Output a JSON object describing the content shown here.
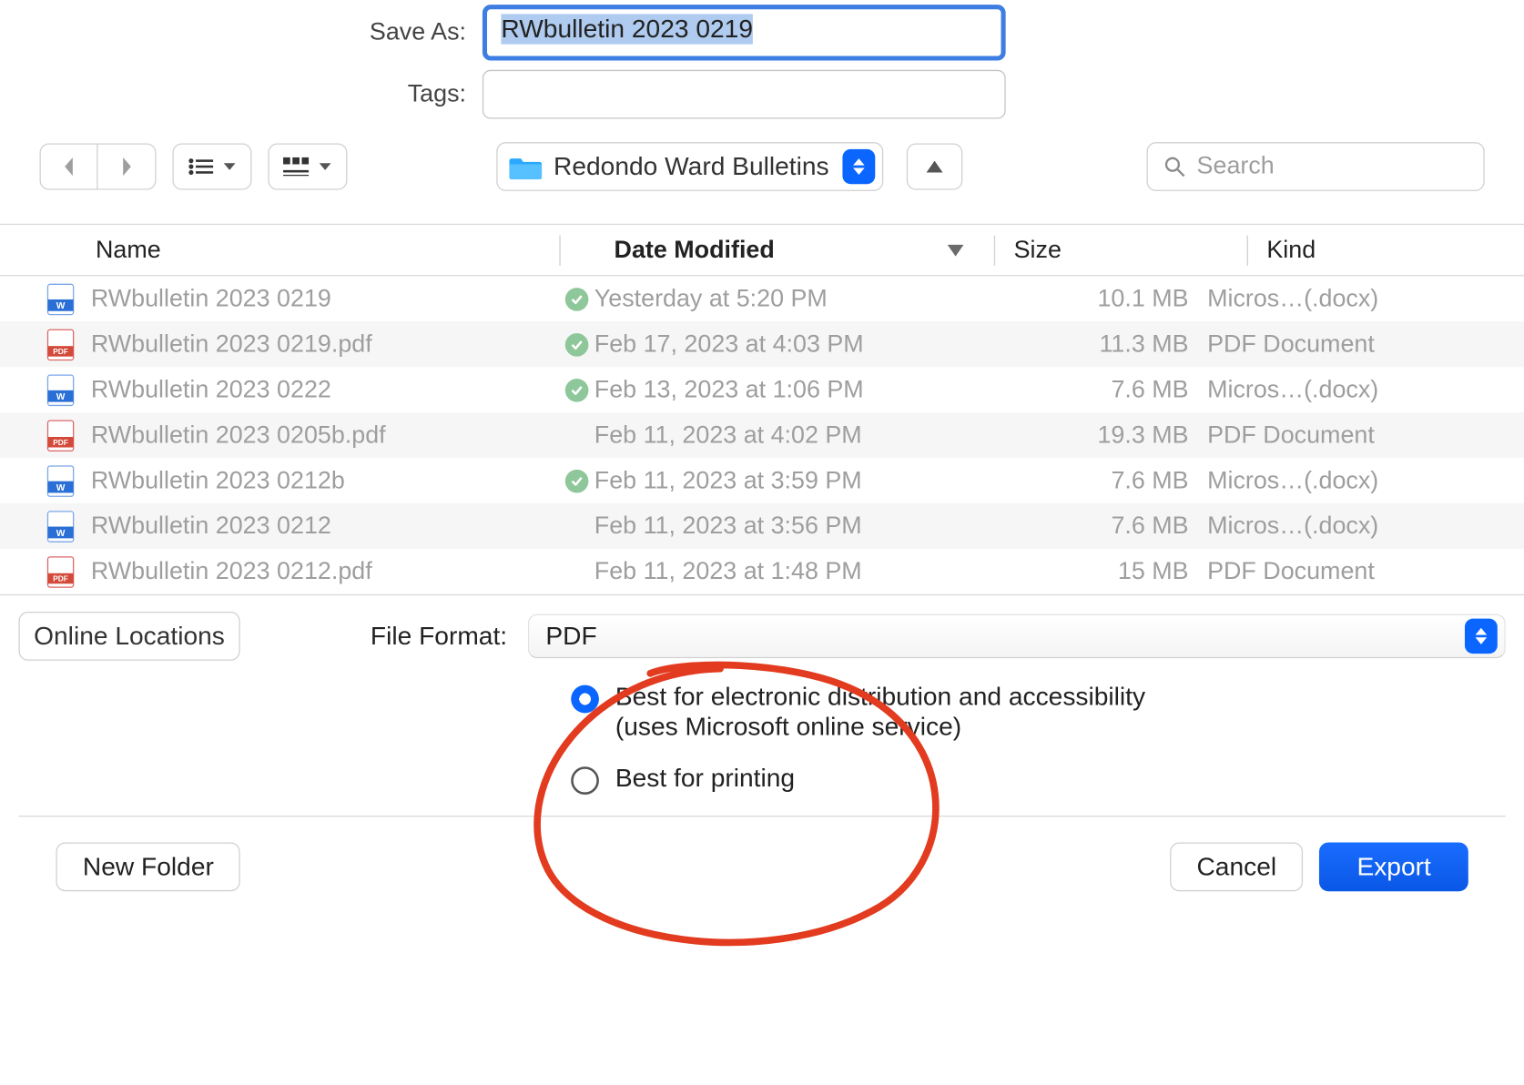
{
  "form": {
    "save_as_label": "Save As:",
    "save_as_value": "RWbulletin 2023 0219",
    "tags_label": "Tags:",
    "tags_value": ""
  },
  "toolbar": {
    "folder_name": "Redondo Ward Bulletins",
    "search_placeholder": "Search"
  },
  "columns": {
    "name": "Name",
    "date": "Date Modified",
    "size": "Size",
    "kind": "Kind"
  },
  "files": [
    {
      "icon": "docx",
      "name": "RWbulletin 2023 0219",
      "synced": true,
      "date": "Yesterday at 5:20 PM",
      "size": "10.1 MB",
      "kind": "Micros…(.docx)"
    },
    {
      "icon": "pdf",
      "name": "RWbulletin 2023 0219.pdf",
      "synced": true,
      "date": "Feb 17, 2023 at 4:03 PM",
      "size": "11.3 MB",
      "kind": "PDF Document"
    },
    {
      "icon": "docx",
      "name": "RWbulletin 2023 0222",
      "synced": true,
      "date": "Feb 13, 2023 at 1:06 PM",
      "size": "7.6 MB",
      "kind": "Micros…(.docx)"
    },
    {
      "icon": "pdf",
      "name": "RWbulletin 2023 0205b.pdf",
      "synced": false,
      "date": "Feb 11, 2023 at 4:02 PM",
      "size": "19.3 MB",
      "kind": "PDF Document"
    },
    {
      "icon": "docx",
      "name": "RWbulletin 2023 0212b",
      "synced": true,
      "date": "Feb 11, 2023 at 3:59 PM",
      "size": "7.6 MB",
      "kind": "Micros…(.docx)"
    },
    {
      "icon": "docx",
      "name": "RWbulletin 2023 0212",
      "synced": false,
      "date": "Feb 11, 2023 at 3:56 PM",
      "size": "7.6 MB",
      "kind": "Micros…(.docx)"
    },
    {
      "icon": "pdf",
      "name": "RWbulletin 2023 0212.pdf",
      "synced": false,
      "date": "Feb 11, 2023 at 1:48 PM",
      "size": "15 MB",
      "kind": "PDF Document"
    }
  ],
  "panel": {
    "online_locations": "Online Locations",
    "file_format_label": "File Format:",
    "file_format_value": "PDF",
    "option1_line1": "Best for electronic distribution and accessibility",
    "option1_line2": "(uses Microsoft online service)",
    "option2": "Best for printing",
    "selected_option": 1
  },
  "footer": {
    "new_folder": "New Folder",
    "cancel": "Cancel",
    "export": "Export"
  },
  "annotation_color": "#e23b1f"
}
